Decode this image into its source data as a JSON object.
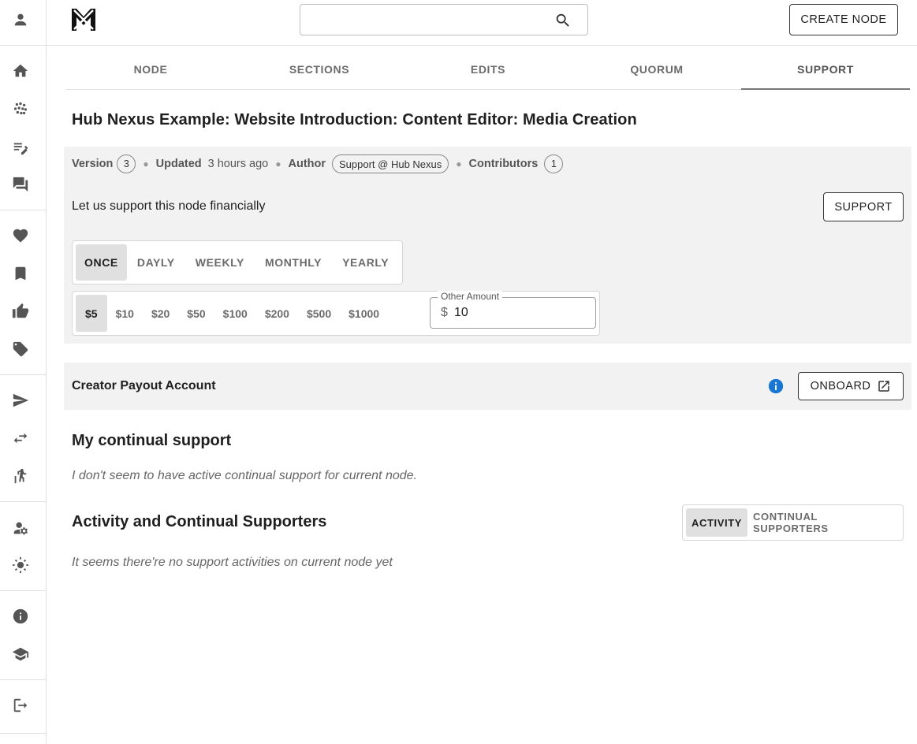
{
  "header": {
    "search_placeholder": "",
    "create_node_label": "CREATE NODE"
  },
  "sidebar": {
    "icons": [
      "account-icon",
      "home-icon",
      "scatter-icon",
      "edit-notes-icon",
      "forum-icon",
      "heart-icon",
      "bookmark-icon",
      "thumb-up-icon",
      "tag-icon",
      "send-icon",
      "swap-icon",
      "climb-icon",
      "manage-account-icon",
      "brightness-icon",
      "info-icon",
      "school-icon",
      "logout-icon"
    ]
  },
  "tabs": [
    {
      "label": "NODE"
    },
    {
      "label": "SECTIONS"
    },
    {
      "label": "EDITS"
    },
    {
      "label": "QUORUM"
    },
    {
      "label": "SUPPORT",
      "active": true
    }
  ],
  "node": {
    "title": "Hub Nexus Example: Website Introduction: Content Editor: Media Creation",
    "meta": {
      "version_label": "Version",
      "version": "3",
      "updated_label": "Updated",
      "updated": "3 hours ago",
      "author_label": "Author",
      "author": "Support @ Hub Nexus",
      "contributors_label": "Contributors",
      "contributors": "1"
    }
  },
  "support": {
    "prompt": "Let us support this node financially",
    "button_label": "SUPPORT",
    "frequencies": [
      "ONCE",
      "DAYLY",
      "WEEKLY",
      "MONTHLY",
      "YEARLY"
    ],
    "selected_frequency": "ONCE",
    "amounts": [
      "$5",
      "$10",
      "$20",
      "$50",
      "$100",
      "$200",
      "$500",
      "$1000"
    ],
    "selected_amount": "$5",
    "other_amount_label": "Other Amount",
    "other_amount_currency": "$",
    "other_amount_value": "10"
  },
  "payout": {
    "title": "Creator Payout Account",
    "onboard_label": "ONBOARD"
  },
  "continual": {
    "title": "My continual support",
    "empty_text": "I don't seem to have active continual support for current node."
  },
  "activity": {
    "title": "Activity and Continual Supporters",
    "toggle": [
      "ACTIVITY",
      "CONTINUAL SUPPORTERS"
    ],
    "selected": "ACTIVITY",
    "empty_text": "It seems there're no support activities on current node yet"
  },
  "colors": {
    "info_blue": "#1976d2",
    "panel_bg": "#f2f2f2",
    "selected_bg": "#e0e0e0"
  }
}
